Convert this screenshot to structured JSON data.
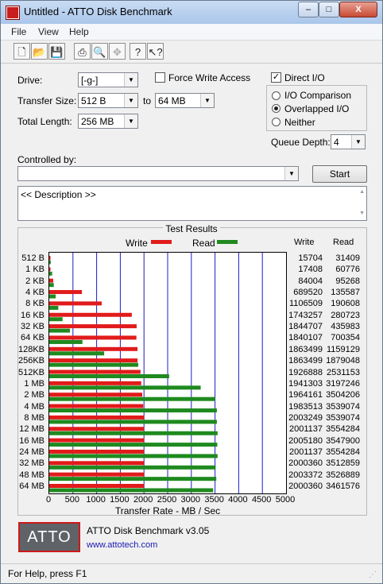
{
  "window": {
    "title": "Untitled - ATTO Disk Benchmark",
    "min": "–",
    "max": "□",
    "close": "X"
  },
  "menu": [
    "File",
    "View",
    "Help"
  ],
  "toolbar": [
    "new-icon",
    "open-icon",
    "save-icon",
    "print-icon",
    "print-preview-icon",
    "move-icon",
    "help-icon",
    "context-help-icon"
  ],
  "settings": {
    "drive_label": "Drive:",
    "drive_value": "[-g-]",
    "transfer_size_label": "Transfer Size:",
    "transfer_from": "512 B",
    "to_label": "to",
    "transfer_to": "64 MB",
    "total_length_label": "Total Length:",
    "total_length_value": "256 MB",
    "force_write_access": "Force Write Access",
    "direct_io": "Direct I/O",
    "io_comparison": "I/O Comparison",
    "overlapped_io": "Overlapped I/O",
    "neither": "Neither",
    "queue_depth_label": "Queue Depth:",
    "queue_depth_value": "4",
    "controlled_by_label": "Controlled by:",
    "start_label": "Start",
    "description": "<< Description >>"
  },
  "results": {
    "title": "Test Results",
    "write_legend": "Write",
    "read_legend": "Read",
    "write_header": "Write",
    "read_header": "Read",
    "xlabel": "Transfer Rate - MB / Sec",
    "rows": [
      {
        "size": "512 B",
        "write": "15704",
        "read": "31409"
      },
      {
        "size": "1 KB",
        "write": "17408",
        "read": "60776"
      },
      {
        "size": "2 KB",
        "write": "84004",
        "read": "95268"
      },
      {
        "size": "4 KB",
        "write": "689520",
        "read": "135587"
      },
      {
        "size": "8 KB",
        "write": "1106509",
        "read": "190608"
      },
      {
        "size": "16 KB",
        "write": "1743257",
        "read": "280723"
      },
      {
        "size": "32 KB",
        "write": "1844707",
        "read": "435983"
      },
      {
        "size": "64 KB",
        "write": "1840107",
        "read": "700354"
      },
      {
        "size": "128KB",
        "write": "1863499",
        "read": "1159129"
      },
      {
        "size": "256KB",
        "write": "1863499",
        "read": "1879048"
      },
      {
        "size": "512KB",
        "write": "1926888",
        "read": "2531153"
      },
      {
        "size": "1 MB",
        "write": "1941303",
        "read": "3197246"
      },
      {
        "size": "2 MB",
        "write": "1964161",
        "read": "3504206"
      },
      {
        "size": "4 MB",
        "write": "1983513",
        "read": "3539074"
      },
      {
        "size": "8 MB",
        "write": "2003249",
        "read": "3539074"
      },
      {
        "size": "12 MB",
        "write": "2001137",
        "read": "3554284"
      },
      {
        "size": "16 MB",
        "write": "2005180",
        "read": "3547900"
      },
      {
        "size": "24 MB",
        "write": "2001137",
        "read": "3554284"
      },
      {
        "size": "32 MB",
        "write": "2000360",
        "read": "3512859"
      },
      {
        "size": "48 MB",
        "write": "2003372",
        "read": "3526889"
      },
      {
        "size": "64 MB",
        "write": "2000360",
        "read": "3461576"
      }
    ]
  },
  "chart_data": {
    "type": "bar",
    "orientation": "horizontal",
    "categories": [
      "512 B",
      "1 KB",
      "2 KB",
      "4 KB",
      "8 KB",
      "16 KB",
      "32 KB",
      "64 KB",
      "128KB",
      "256KB",
      "512KB",
      "1 MB",
      "2 MB",
      "4 MB",
      "8 MB",
      "12 MB",
      "16 MB",
      "24 MB",
      "32 MB",
      "48 MB",
      "64 MB"
    ],
    "series": [
      {
        "name": "Write",
        "color": "#e11b1b",
        "values": [
          15.704,
          17.408,
          84.004,
          689.52,
          1106.509,
          1743.257,
          1844.707,
          1840.107,
          1863.499,
          1863.499,
          1926.888,
          1941.303,
          1964.161,
          1983.513,
          2003.249,
          2001.137,
          2005.18,
          2001.137,
          2000.36,
          2003.372,
          2000.36
        ]
      },
      {
        "name": "Read",
        "color": "#1f8a1f",
        "values": [
          31.409,
          60.776,
          95.268,
          135.587,
          190.608,
          280.723,
          435.983,
          700.354,
          1159.129,
          1879.048,
          2531.153,
          3197.246,
          3504.206,
          3539.074,
          3539.074,
          3554.284,
          3547.9,
          3554.284,
          3512.859,
          3526.889,
          3461.576
        ]
      }
    ],
    "xlim": [
      0,
      5000
    ],
    "xticks": [
      "0",
      "500",
      "1000",
      "1500",
      "2000",
      "2500",
      "3000",
      "3500",
      "4000",
      "4500",
      "5000"
    ],
    "xlabel": "Transfer Rate - MB / Sec",
    "grid": "vertical",
    "grid_color": "#1c1cc8"
  },
  "footer": {
    "version": "ATTO Disk Benchmark v3.05",
    "link": "www.attotech.com",
    "logo": "ATTO"
  },
  "status": "For Help, press F1"
}
